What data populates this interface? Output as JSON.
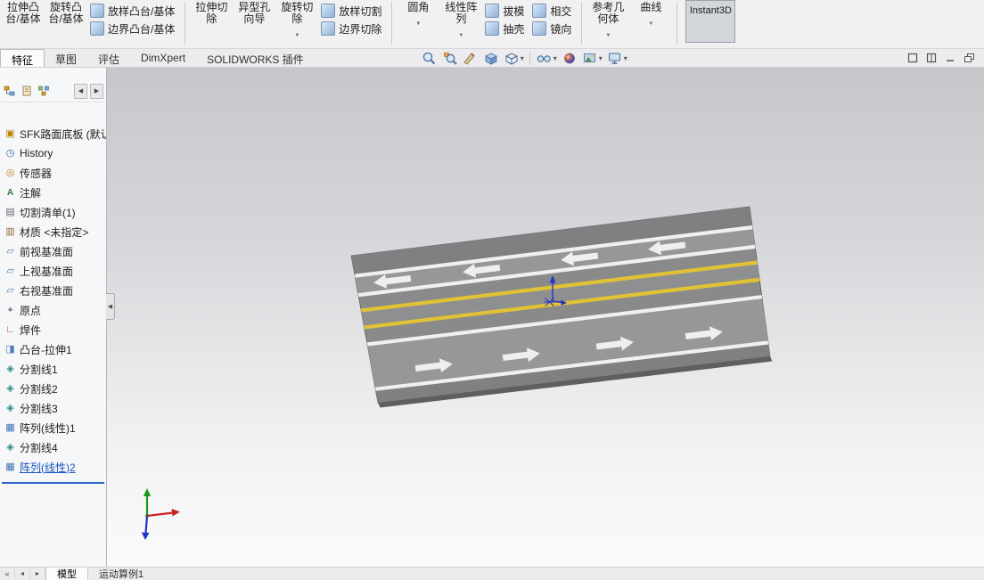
{
  "command_tabs": {
    "features": "特征",
    "sketch": "草图",
    "evaluate": "评估",
    "dimxpert": "DimXpert",
    "addins": "SOLIDWORKS 插件"
  },
  "ribbon": {
    "extrude_boss": "拉伸凸台/基体",
    "revolve_boss": "旋转凸台/基体",
    "loft_boss": "放样凸台/基体",
    "boundary_boss": "边界凸台/基体",
    "extrude_cut": "拉伸切除",
    "hole_wizard": "异型孔向导",
    "revolve_cut": "旋转切除",
    "loft_cut": "放样切割",
    "boundary_cut": "边界切除",
    "fillet": "圆角",
    "linear_pattern": "线性阵列",
    "draft": "拔模",
    "shell": "抽壳",
    "intersect": "相交",
    "mirror": "镜向",
    "reference_geometry": "参考几何体",
    "curves": "曲线",
    "instant3d": "Instant3D"
  },
  "view_toolbar": {
    "buttons": [
      "zoom-fit",
      "zoom-area",
      "section-view",
      "view-orientation",
      "display-style",
      "hide-show",
      "edit-appearance",
      "apply-scene",
      "view-settings"
    ]
  },
  "feature_tree": {
    "root": "SFK路面底板 (默认<",
    "root_icon": "part",
    "items": [
      {
        "label": "History",
        "icon": "history"
      },
      {
        "label": "传感器",
        "icon": "sensors"
      },
      {
        "label": "注解",
        "icon": "annotations"
      },
      {
        "label": "切割清单(1)",
        "icon": "cut-list"
      },
      {
        "label": "材质 <未指定>",
        "icon": "material"
      },
      {
        "label": "前视基准面",
        "icon": "plane"
      },
      {
        "label": "上视基准面",
        "icon": "plane"
      },
      {
        "label": "右视基准面",
        "icon": "plane"
      },
      {
        "label": "原点",
        "icon": "origin"
      },
      {
        "label": "焊件",
        "icon": "weldment"
      },
      {
        "label": "凸台-拉伸1",
        "icon": "extrude"
      },
      {
        "label": "分割线1",
        "icon": "split-line"
      },
      {
        "label": "分割线2",
        "icon": "split-line"
      },
      {
        "label": "分割线3",
        "icon": "split-line"
      },
      {
        "label": "阵列(线性)1",
        "icon": "pattern"
      },
      {
        "label": "分割线4",
        "icon": "split-line"
      },
      {
        "label": "阵列(线性)2",
        "icon": "pattern"
      }
    ]
  },
  "bottom_bar": {
    "model_tab": "模型",
    "motion_tab": "运动算例1",
    "nav": [
      "first",
      "previous",
      "next"
    ]
  },
  "colors": {
    "road_surface": "#8a8a8a",
    "lane_band": "#979797",
    "line_white": "#f0f0ee",
    "line_yellow": "#e2c235",
    "arrow_white": "#efefef",
    "origin_blue": "#2233cc",
    "triad_x_red": "#cc2222",
    "triad_y_green": "#1a9a1a",
    "triad_z_blue": "#2233cc",
    "selection_blue": "#1a56c4"
  }
}
